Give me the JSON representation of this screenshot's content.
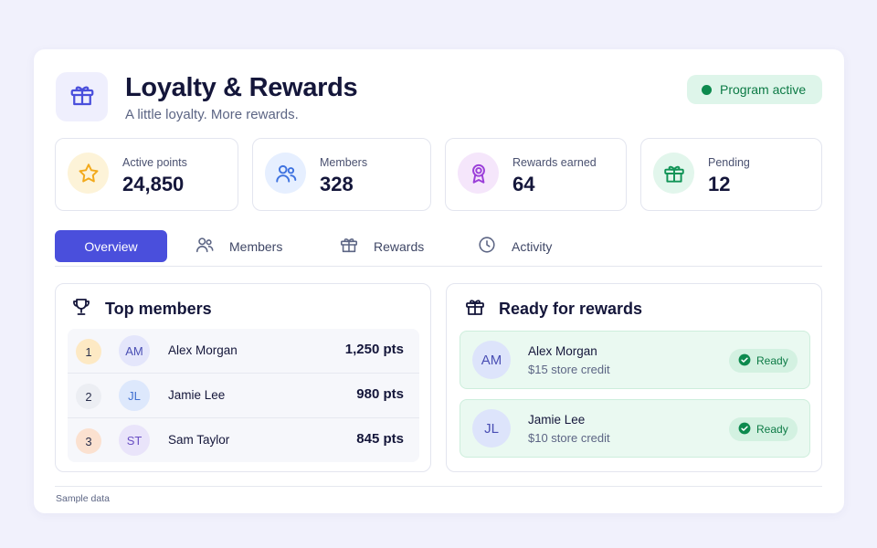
{
  "header": {
    "title": "Loyalty & Rewards",
    "subtitle": "A little loyalty. More rewards.",
    "status": "Program active",
    "logo_icon": "gift-icon"
  },
  "stats": [
    {
      "label": "Active points",
      "value": "24,850",
      "icon": "star-icon",
      "color": "#f2a91b"
    },
    {
      "label": "Members",
      "value": "328",
      "icon": "users-icon",
      "color": "#3f73e0"
    },
    {
      "label": "Rewards earned",
      "value": "64",
      "icon": "award-icon",
      "color": "#9b3fd9"
    },
    {
      "label": "Pending",
      "value": "12",
      "icon": "gift-icon",
      "color": "#119457"
    }
  ],
  "tabs": [
    {
      "label": "Overview",
      "icon": "",
      "active": true
    },
    {
      "label": "Members",
      "icon": "users-icon"
    },
    {
      "label": "Rewards",
      "icon": "gift-icon"
    },
    {
      "label": "Activity",
      "icon": "clock-icon"
    }
  ],
  "top_members": {
    "title": "Top members",
    "icon": "trophy-icon",
    "rows": [
      {
        "rank": "1",
        "initials": "AM",
        "name": "Alex Morgan",
        "points": "1,250 pts"
      },
      {
        "rank": "2",
        "initials": "JL",
        "name": "Jamie Lee",
        "points": "980 pts"
      },
      {
        "rank": "3",
        "initials": "ST",
        "name": "Sam Taylor",
        "points": "845 pts"
      }
    ]
  },
  "ready_rewards": {
    "title": "Ready for rewards",
    "icon": "gift-icon",
    "items": [
      {
        "initials": "AM",
        "name": "Alex Morgan",
        "reward": "$15 store credit",
        "status": "Ready"
      },
      {
        "initials": "JL",
        "name": "Jamie Lee",
        "reward": "$10 store credit",
        "status": "Ready"
      }
    ]
  },
  "footer": {
    "note": "Sample data"
  },
  "colors": {
    "accent": "#4a4fdc",
    "success": "#0d8a4e",
    "success_bg": "#def5ea",
    "text_dark": "#14163a"
  }
}
